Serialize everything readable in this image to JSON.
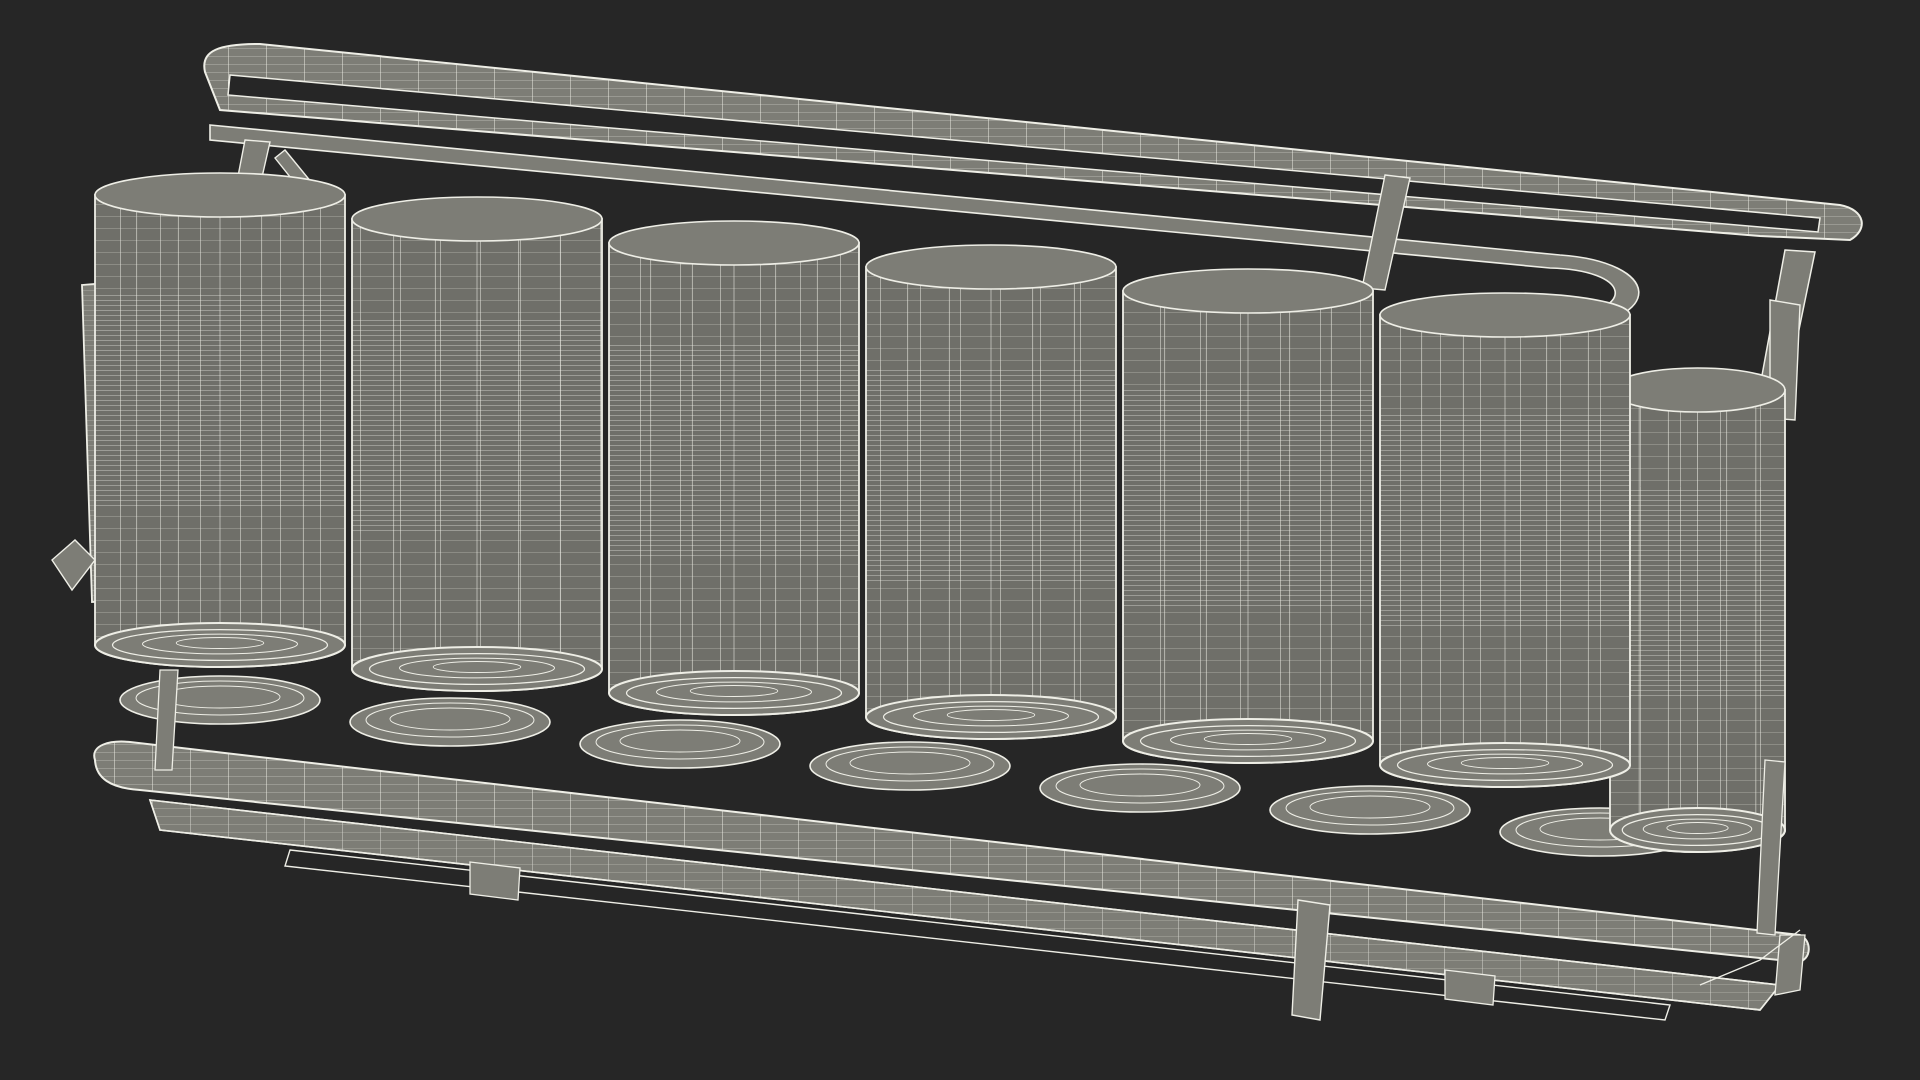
{
  "scene": {
    "subject": "wireframe-can-carrier",
    "background_color": "#262626",
    "mesh_color": "#7d7d76",
    "mesh_shade_color": "#6f6f69",
    "wire_color": "#eeeee6",
    "can_count_front_row": 7,
    "can_count_back_row": 7
  }
}
